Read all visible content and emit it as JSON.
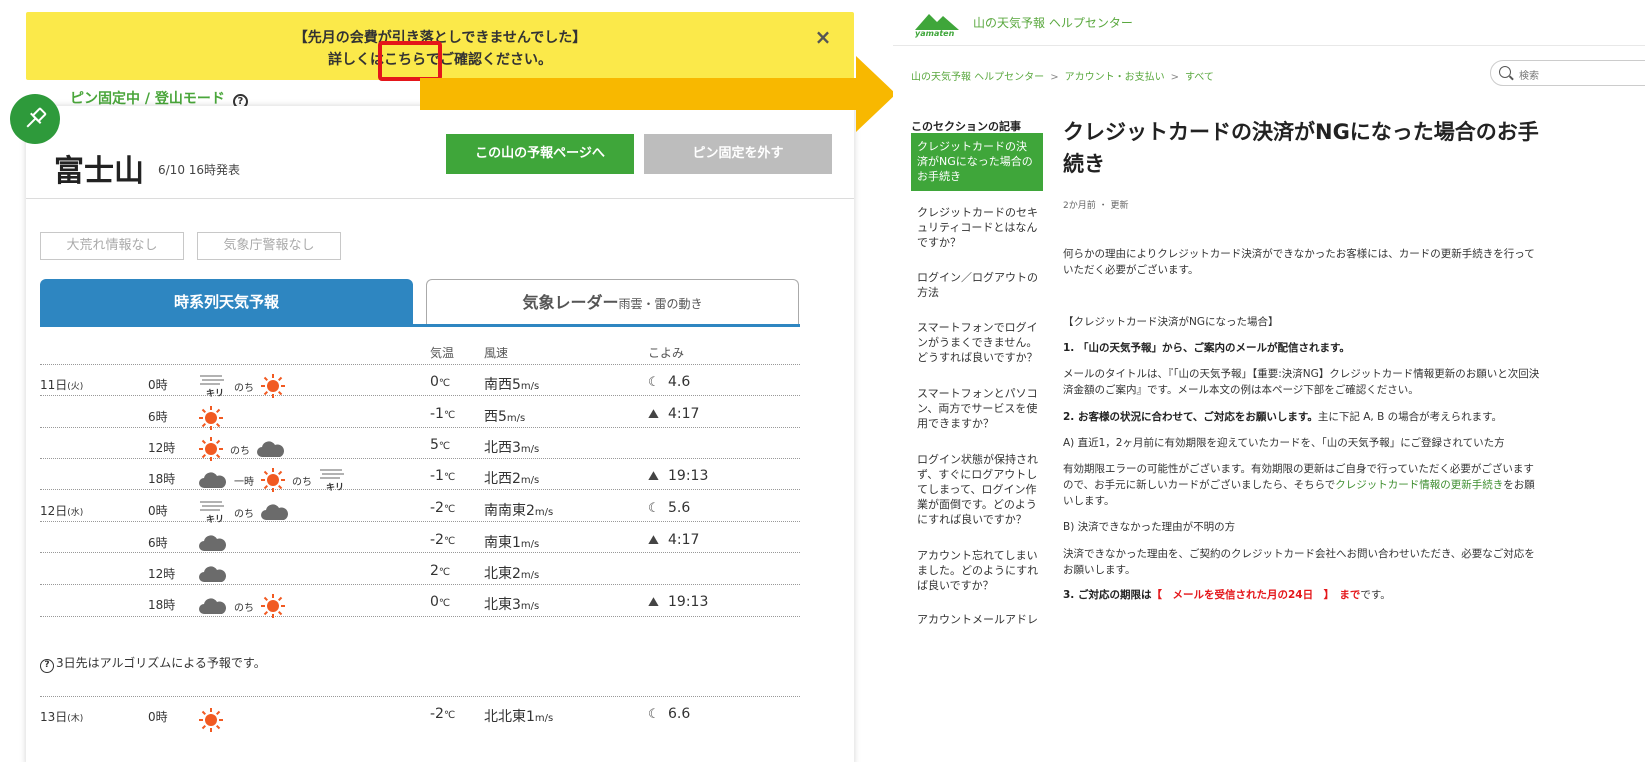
{
  "banner": {
    "line1": "【先月の会費が引き落としできませんでした】",
    "line2_pre": "詳しくは",
    "line2_link": "こちら",
    "line2_post": "でご確認ください。",
    "close": "×"
  },
  "pin": {
    "mode_label": "ピン固定中 / 登山モード",
    "help": "?"
  },
  "mountain": {
    "name": "富士山",
    "release": "6/10 16時発表",
    "forecast_button": "この山の予報ページへ",
    "unpin_button": "ピン固定を外す"
  },
  "warnings": {
    "storm": "大荒れ情報なし",
    "jma": "気象庁警報なし"
  },
  "tabs": {
    "timeseries": "時系列天気予報",
    "radar_main": "気象レーダー",
    "radar_sub": "雨雲・雷の動き"
  },
  "table": {
    "headers": {
      "temp": "気温",
      "wind": "風速",
      "koyomi": "こよみ"
    },
    "days": [
      {
        "date": "11日",
        "dow": "(火)"
      },
      {
        "date": "12日",
        "dow": "(水)"
      },
      {
        "date": "13日",
        "dow": "(木)"
      }
    ],
    "rows": [
      {
        "time": "0時",
        "temp": "0",
        "unit": "℃",
        "wind": "南西5",
        "wunit": "m/s",
        "koyomi": "4.6",
        "kicon": "moon"
      },
      {
        "time": "6時",
        "temp": "-1",
        "unit": "℃",
        "wind": "西5",
        "wunit": "m/s",
        "koyomi": "4:17",
        "kicon": "sunrise"
      },
      {
        "time": "12時",
        "temp": "5",
        "unit": "℃",
        "wind": "北西3",
        "wunit": "m/s",
        "koyomi": "",
        "kicon": ""
      },
      {
        "time": "18時",
        "temp": "-1",
        "unit": "℃",
        "wind": "北西2",
        "wunit": "m/s",
        "koyomi": "19:13",
        "kicon": "sunset"
      },
      {
        "time": "0時",
        "temp": "-2",
        "unit": "℃",
        "wind": "南南東2",
        "wunit": "m/s",
        "koyomi": "5.6",
        "kicon": "moon"
      },
      {
        "time": "6時",
        "temp": "-2",
        "unit": "℃",
        "wind": "南東1",
        "wunit": "m/s",
        "koyomi": "4:17",
        "kicon": "sunrise"
      },
      {
        "time": "12時",
        "temp": "2",
        "unit": "℃",
        "wind": "北東2",
        "wunit": "m/s",
        "koyomi": "",
        "kicon": ""
      },
      {
        "time": "18時",
        "temp": "0",
        "unit": "℃",
        "wind": "北東3",
        "wunit": "m/s",
        "koyomi": "19:13",
        "kicon": "sunset"
      },
      {
        "time": "0時",
        "temp": "-2",
        "unit": "℃",
        "wind": "北北東1",
        "wunit": "m/s",
        "koyomi": "6.6",
        "kicon": "moon"
      }
    ],
    "fog_label": "キリ",
    "then": "のち",
    "temporary": "一時",
    "note": "3日先はアルゴリズムによる予報です。"
  },
  "helpcenter": {
    "title": "山の天気予報 ヘルプセンター",
    "logo_text": "yamaten",
    "logo_sub": "山の天気予報",
    "breadcrumbs": [
      "山の天気予報 ヘルプセンター",
      "アカウント・お支払い",
      "すべて"
    ],
    "search_placeholder": "検索",
    "section_label": "このセクションの記事",
    "sidebar": [
      "クレジットカードの決済がNGになった場合のお手続き",
      "クレジットカードのセキュリティコードとはなんですか？",
      "ログイン／ログアウトの方法",
      "スマートフォンでログインがうまくできません。どうすれば良いですか？",
      "スマートフォンとパソコン、両方でサービスを使用できますか？",
      "ログイン状態が保持されず、すぐにログアウトしてしまって、ログイン作業が面倒です。どのようにすれば良いですか？",
      "アカウント忘れてしまいました。どのようにすれば良いですか？",
      "アカウントメールアドレ"
    ],
    "article": {
      "title": "クレジットカードの決済がNGになった場合のお手続き",
      "meta": "2か月前 ・ 更新",
      "intro": "何らかの理由によりクレジットカード決済ができなかったお客様には、カードの更新手続きを行っていただく必要がございます。",
      "h_case": "【クレジットカード決済がNGになった場合】",
      "s1": "1. 「山の天気予報」から、ご案内のメールが配信されます。",
      "s1_body": "メールのタイトルは、『「山の天気予報」【重要:決済NG】クレジットカード情報更新のお願いと次回決済金額のご案内』です。メール本文の例は本ページ下部をご確認ください。",
      "s2": "2. お客様の状況に合わせて、ご対応をお願いします。",
      "s2_tail": "主に下記 A, B の場合が考えられます。",
      "a_label": "A) 直近1，2ヶ月前に有効期限を迎えていたカードを、「山の天気予報」にご登録されていた方",
      "a_body_pre": "有効期限エラーの可能性がございます。有効期限の更新はご自身で行っていただく必要がございますので、お手元に新しいカードがございましたら、そちらで",
      "a_body_link": "クレジットカード情報の更新手続き",
      "a_body_post": "をお願いします。",
      "b_label": "B) 決済できなかった理由が不明の方",
      "b_body": "決済できなかった理由を、ご契約のクレジットカード会社へお問い合わせいただき、必要なご対応をお願いします。",
      "s3_pre": "3. ご対応の期限は",
      "s3_red": "【　メールを受信された月の24日　】　まで",
      "s3_post": "です。"
    }
  },
  "colors": {
    "banner": "#fbe94a",
    "highlight": "#e4161a",
    "green": "#3fa63a",
    "blue_tab": "#2e86c1",
    "arrow": "#f8b800",
    "sun": "#f15a22",
    "cloud": "#6b6b6b"
  }
}
